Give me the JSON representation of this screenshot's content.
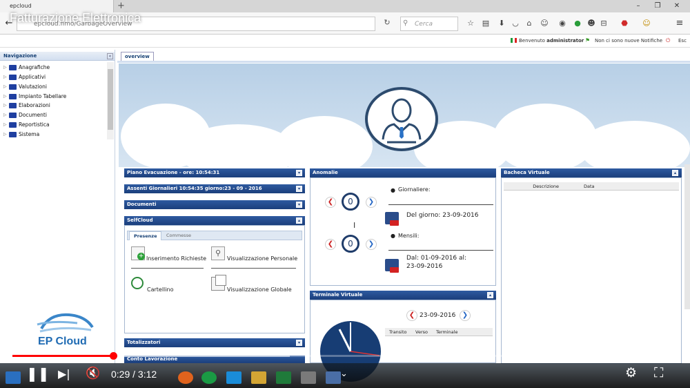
{
  "browser": {
    "tab_title": "epcloud",
    "new_tab": "+",
    "url": "epcloud.fimo/GarbageOverview",
    "search_placeholder": "Cerca",
    "window_minimize": "–",
    "window_restore": "❐",
    "window_close": "✕"
  },
  "video": {
    "title": "Fatturazione Elettronica",
    "time": "0:29 / 3:12",
    "progress": 0.151
  },
  "app_header": {
    "welcome_prefix": "Benvenuto",
    "user": "administrator",
    "notifications": "Non ci sono nuove Notifiche",
    "exit": "Esc"
  },
  "sidebar": {
    "title": "Navigazione",
    "collapse": "«",
    "items": [
      {
        "label": "Anagrafiche"
      },
      {
        "label": "Applicativi"
      },
      {
        "label": "Valutazioni"
      },
      {
        "label": "Impianto Tabellare"
      },
      {
        "label": "Elaborazioni"
      },
      {
        "label": "Documenti"
      },
      {
        "label": "Reportistica"
      },
      {
        "label": "Sistema"
      }
    ]
  },
  "main": {
    "tab": "overview",
    "panels": {
      "piano": "Piano Evacuazione - ore: 10:54:31",
      "assenti": "Assenti Giornalieri 10:54:35 giorno:23 - 09 - 2016",
      "documenti": "Documenti",
      "selfcloud": "SelfCloud",
      "totalizzatori": "Totalizzatori",
      "conto": "Conto Lavorazione",
      "anomalie": "Anomalie",
      "terminale": "Terminale Virtuale",
      "bacheca": "Bacheca Virtuale"
    },
    "selfcloud": {
      "tabs": [
        "Presenze",
        "Commesse"
      ],
      "actions": {
        "inserimento": "Inserimento Richieste",
        "visual_personale": "Visualizzazione Personale",
        "cartellino": "Cartellino",
        "visual_globale": "Visualizzazione Globale"
      }
    },
    "anomalie": {
      "count_daily": "0",
      "count_monthly": "0",
      "giornaliere": "Giornaliere:",
      "del_giorno": "Del giorno: 23-09-2016",
      "mensili": "Mensili:",
      "dal_line1": "Dal: 01-09-2016 al:",
      "dal_line2": "23-09-2016"
    },
    "terminale": {
      "date": "23-09-2016",
      "columns": [
        "Transito",
        "Verso",
        "Terminale"
      ]
    },
    "bacheca": {
      "columns": [
        "Descrizione",
        "Data"
      ]
    }
  },
  "logo": {
    "text": "EP Cloud"
  }
}
